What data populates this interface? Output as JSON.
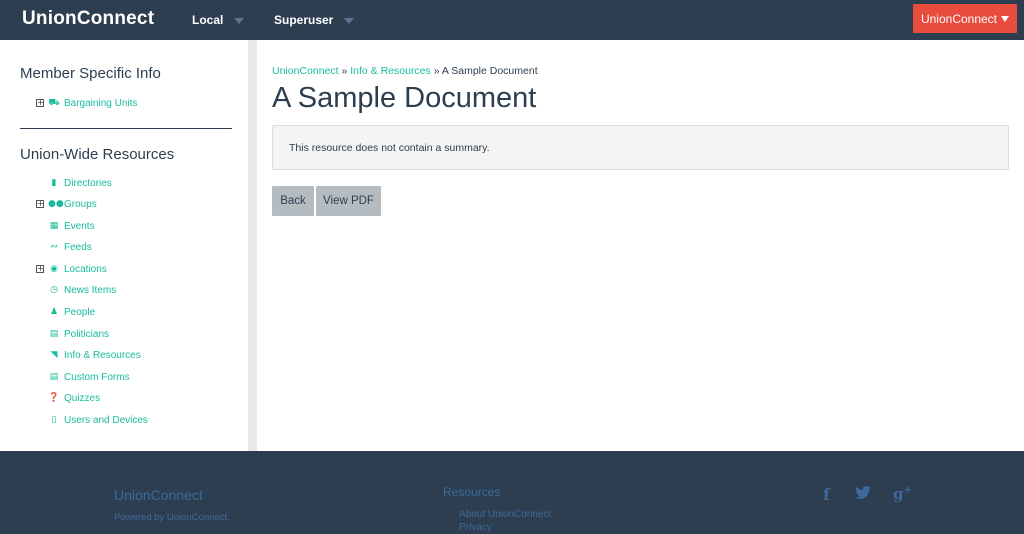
{
  "header": {
    "brand": "UnionConnect",
    "menu_local": "Local",
    "menu_superuser": "Superuser",
    "org_button": "UnionConnect"
  },
  "sidebar": {
    "member_title": "Member Specific Info",
    "member_items": [
      {
        "label": "Bargaining Units",
        "icon": "truck-icon",
        "expandable": true
      }
    ],
    "union_title": "Union-Wide Resources",
    "union_items": [
      {
        "label": "Directories",
        "icon": "book-icon",
        "expandable": false
      },
      {
        "label": "Groups",
        "icon": "users-icon",
        "expandable": true
      },
      {
        "label": "Events",
        "icon": "calendar-icon",
        "expandable": false
      },
      {
        "label": "Feeds",
        "icon": "rss-icon",
        "expandable": false
      },
      {
        "label": "Locations",
        "icon": "globe-icon",
        "expandable": true
      },
      {
        "label": "News Items",
        "icon": "clock-icon",
        "expandable": false
      },
      {
        "label": "People",
        "icon": "user-icon",
        "expandable": false
      },
      {
        "label": "Politicians",
        "icon": "building-icon",
        "expandable": false
      },
      {
        "label": "Info & Resources",
        "icon": "folder-open-icon",
        "expandable": false
      },
      {
        "label": "Custom Forms",
        "icon": "list-alt-icon",
        "expandable": false
      },
      {
        "label": "Quizzes",
        "icon": "question-circle-icon",
        "expandable": false
      },
      {
        "label": "Users and Devices",
        "icon": "mobile-icon",
        "expandable": false
      }
    ]
  },
  "main": {
    "breadcrumb": {
      "home": "UnionConnect",
      "sep": " » ",
      "section": "Info & Resources",
      "current": "A Sample Document"
    },
    "title": "A Sample Document",
    "summary": "This resource does not contain a summary.",
    "back_label": "Back",
    "pdf_label": "View PDF"
  },
  "footer": {
    "brand": "UnionConnect",
    "powered": "Powered by UnionConnect.",
    "resources_title": "Resources",
    "links": [
      "About UnionConnect",
      "Privacy"
    ],
    "social": {
      "facebook": "f",
      "twitter": "🐦",
      "googleplus": "g+"
    }
  },
  "colors": {
    "navbar": "#2c3e50",
    "accent": "#18bc9c",
    "danger": "#e74c3c",
    "button": "#b4bcc2"
  }
}
